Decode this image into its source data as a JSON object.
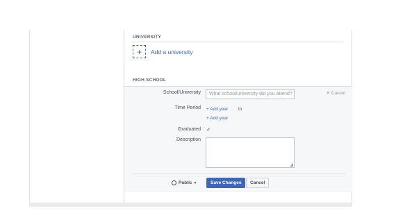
{
  "university": {
    "section_title": "UNIVERSITY",
    "add_label": "Add a university",
    "plus_icon": "+"
  },
  "high_school": {
    "section_title": "HIGH SCHOOL",
    "cancel_label": "Cancel",
    "fields": {
      "school_label": "School/University",
      "school_placeholder": "What school/university did you attend?",
      "time_period_label": "Time Period",
      "add_year_start": "+ Add year",
      "to_label": "to",
      "add_year_end": "+ Add year",
      "graduated_label": "Graduated",
      "graduated_checked": true,
      "description_label": "Description",
      "description_value": ""
    },
    "footer": {
      "privacy_label": "Public",
      "privacy_icon": "globe-icon",
      "save_label": "Save Changes",
      "cancel_label": "Cancel"
    }
  },
  "colors": {
    "accent": "#4267b2",
    "panel_bg": "#f6f7f9",
    "border": "#dddfe2"
  }
}
